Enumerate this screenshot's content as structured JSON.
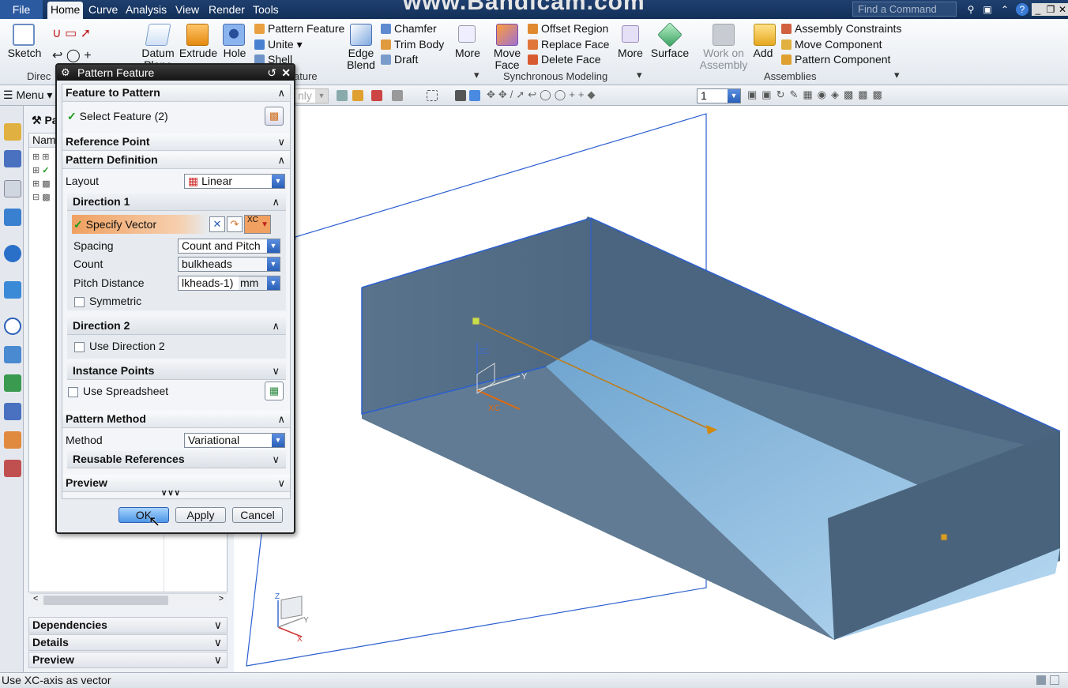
{
  "watermark": "www.Bandicam.com",
  "menubar": {
    "file": "File",
    "tabs": [
      "Home",
      "Curve",
      "Analysis",
      "View",
      "Render",
      "Tools"
    ],
    "find_placeholder": "Find a Command"
  },
  "ribbon": {
    "sketch": "Sketch",
    "datum": "Datum",
    "datum2": "Plane",
    "extrude": "Extrude",
    "hole": "Hole",
    "pattern_feature": "Pattern Feature",
    "unite": "Unite",
    "shell": "Shell",
    "edge_blend_1": "Edge",
    "edge_blend_2": "Blend",
    "chamfer": "Chamfer",
    "trim_body": "Trim Body",
    "draft": "Draft",
    "more1": "More",
    "move_face_1": "Move",
    "move_face_2": "Face",
    "offset_region": "Offset Region",
    "replace_face": "Replace Face",
    "delete_face": "Delete Face",
    "more2": "More",
    "surface": "Surface",
    "work_on_1": "Work on",
    "work_on_2": "Assembly",
    "add": "Add",
    "assembly_constraints": "Assembly Constraints",
    "move_component": "Move Component",
    "pattern_component": "Pattern Component",
    "group_direct": "Direc",
    "group_feature": "ature",
    "group_sync": "Synchronous Modeling",
    "group_assemblies": "Assemblies"
  },
  "toolbar2": {
    "menu": "Menu",
    "filter": "nly",
    "layer": "1"
  },
  "nav": {
    "title": "Pa",
    "col_name": "Nam",
    "dependencies": "Dependencies",
    "details": "Details",
    "preview": "Preview"
  },
  "dialog": {
    "title": "Pattern Feature",
    "feature_to_pattern": "Feature to Pattern",
    "select_feature": "Select Feature (2)",
    "reference_point": "Reference Point",
    "pattern_definition": "Pattern Definition",
    "layout_label": "Layout",
    "layout_value": "Linear",
    "direction1": "Direction 1",
    "specify_vector": "Specify Vector",
    "vector_xc": "XC",
    "spacing_label": "Spacing",
    "spacing_value": "Count and Pitch",
    "count_label": "Count",
    "count_value": "bulkheads",
    "pitch_label": "Pitch Distance",
    "pitch_value": "lkheads-1)",
    "pitch_unit": "mm",
    "symmetric": "Symmetric",
    "direction2": "Direction 2",
    "use_direction2": "Use Direction 2",
    "instance_points": "Instance Points",
    "use_spreadsheet": "Use Spreadsheet",
    "pattern_method": "Pattern Method",
    "method_label": "Method",
    "method_value": "Variational",
    "reusable_references": "Reusable References",
    "preview": "Preview",
    "ok": "OK",
    "apply": "Apply",
    "cancel": "Cancel"
  },
  "viewport": {
    "axis_y": "Y",
    "axis_xc": "XC",
    "axis_zc": "ZC",
    "tri_z": "Z",
    "tri_y": "Y",
    "tri_x": "X"
  },
  "status": "Use XC-axis as vector"
}
